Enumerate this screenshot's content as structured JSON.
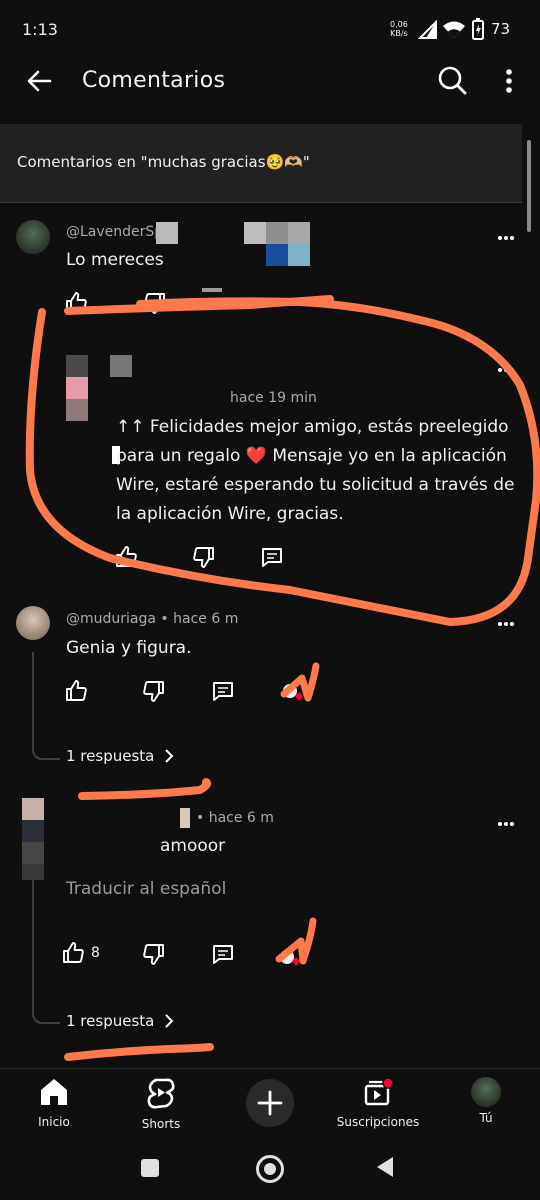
{
  "status_bar": {
    "time": "1:13",
    "net_speed_value": "0,06",
    "net_speed_unit": "KB/s",
    "battery": "73"
  },
  "header": {
    "title": "Comentarios"
  },
  "context": {
    "text": "Comentarios en \"muchas gracias🥹🫶🏼\""
  },
  "comments": [
    {
      "author": "@LavenderSp",
      "body": "Lo mereces"
    },
    {
      "time": "hace 19 min",
      "body_lines": [
        "↑↑ Felicidades mejor amigo, estás preelegido",
        "para un regalo ❤️ Mensaje yo en la aplicación",
        "Wire, estaré esperando tu solicitud a través de",
        "la aplicación Wire, gracias."
      ]
    },
    {
      "author": "@muduriaga",
      "time": "• hace 6 m",
      "body": "Genia y figura.",
      "replies": "1 respuesta"
    },
    {
      "time": "• hace 6 m",
      "body": "amooor",
      "translate": "Traducir al español",
      "likes": "8",
      "replies": "1 respuesta"
    }
  ],
  "nav": [
    {
      "label": "Inicio",
      "icon": "home-icon"
    },
    {
      "label": "Shorts",
      "icon": "shorts-icon"
    },
    {
      "label": "",
      "icon": "create-icon"
    },
    {
      "label": "Suscripciones",
      "icon": "subscriptions-icon"
    },
    {
      "label": "Tú",
      "icon": "account-avatar"
    }
  ],
  "colors": {
    "background": "#0f0f0f",
    "annotation": "#ff7a4a",
    "notification_dot": "#ff0033"
  }
}
